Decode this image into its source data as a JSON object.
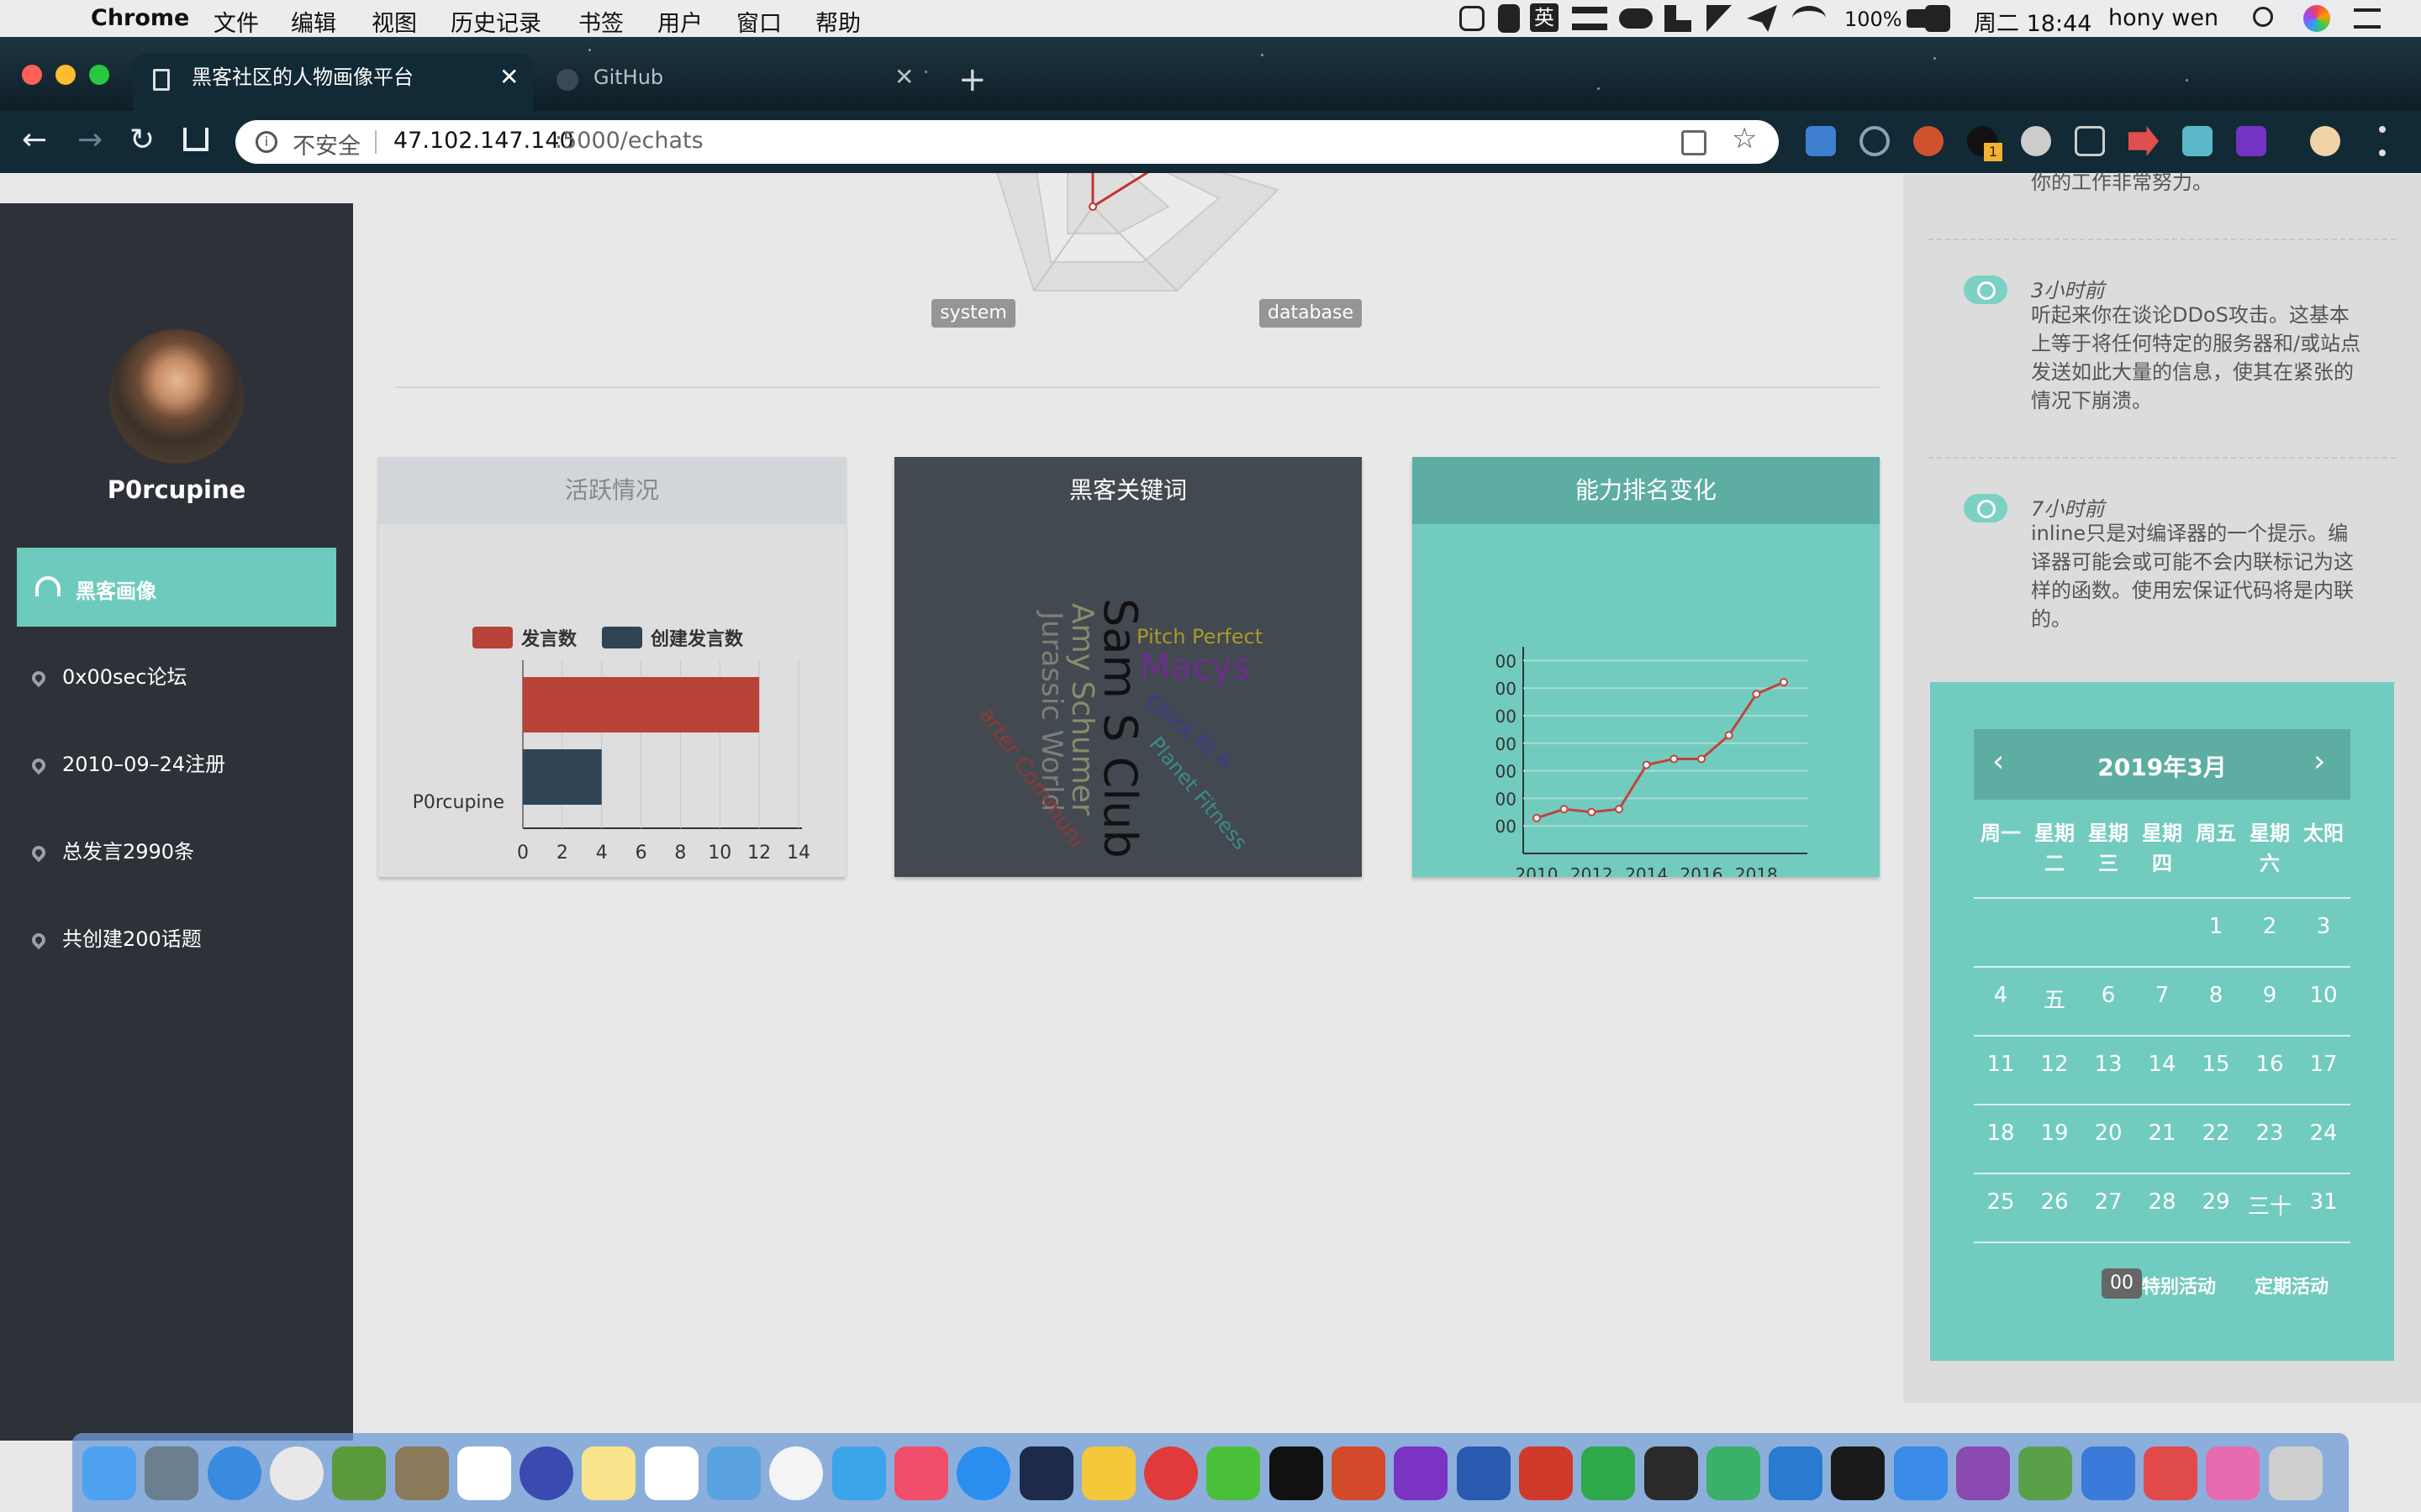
{
  "menubar": {
    "app": "Chrome",
    "menus": [
      "文件",
      "编辑",
      "视图",
      "历史记录",
      "书签",
      "用户",
      "窗口",
      "帮助"
    ],
    "input_method": "英",
    "battery": "100%",
    "clock": "周二 18:44",
    "user": "hony wen"
  },
  "browser": {
    "tabs": [
      {
        "title": "黑客社区的人物画像平台"
      },
      {
        "title": "GitHub"
      }
    ],
    "security_label": "不安全",
    "url_host": "47.102.147.140",
    "url_rest": ":5000/echats",
    "ext_badge": "1"
  },
  "profile": {
    "name": "P0rcupine"
  },
  "nav": {
    "active_label": "黑客画像",
    "items": [
      {
        "label": "0x00sec论坛"
      },
      {
        "label": "2010–09–24注册"
      },
      {
        "label": "总发言2990条"
      },
      {
        "label": "共创建200话题"
      }
    ]
  },
  "radar": {
    "labels": [
      "system",
      "database"
    ]
  },
  "cards": [
    {
      "title": "活跃情况"
    },
    {
      "title": "黑客关键词"
    },
    {
      "title": "能力排名变化"
    }
  ],
  "activity_chart": {
    "chart_data": {
      "type": "bar",
      "orientation": "horizontal",
      "categories": [
        "P0rcupine"
      ],
      "series": [
        {
          "name": "发言数",
          "values": [
            12
          ],
          "color": "#b94239"
        },
        {
          "name": "创建发言数",
          "values": [
            4
          ],
          "color": "#2f4454"
        }
      ],
      "xlim": [
        0,
        14
      ],
      "xticks": [
        "0",
        "2",
        "4",
        "6",
        "8",
        "10",
        "12",
        "14"
      ],
      "legend": "top"
    }
  },
  "wordcloud": {
    "words": [
      {
        "text": "Sam S Club",
        "color": "#111111"
      },
      {
        "text": "Amy Schumer",
        "color": "#8a8a6e"
      },
      {
        "text": "Jurassic World",
        "color": "#7b7f78"
      },
      {
        "text": "Macys",
        "color": "#6b2f8c"
      },
      {
        "text": "Pitch Perfect",
        "color": "#a89a2c"
      },
      {
        "text": "Chick Fil A",
        "color": "#3b3a8f"
      },
      {
        "text": "Planet Fitness",
        "color": "#3c8a8c"
      },
      {
        "text": "arter Communi",
        "color": "#8a3a36"
      }
    ]
  },
  "rank_chart": {
    "chart_data": {
      "type": "line",
      "x": [
        2010,
        2011,
        2012,
        2013,
        2014,
        2015,
        2016,
        2017,
        2018,
        2019
      ],
      "series": [
        {
          "values": [
            1.2,
            1.5,
            1.4,
            1.5,
            3.0,
            3.2,
            3.2,
            4.0,
            5.4,
            5.8
          ],
          "color": "#c0453e"
        }
      ],
      "ylim": [
        0,
        7
      ],
      "ytick_labels": [
        "00",
        "00",
        "00",
        "00",
        "00",
        "00",
        "00"
      ],
      "xticks": [
        "2010",
        "2012",
        "2014",
        "2016",
        "2018"
      ]
    }
  },
  "feed": [
    {
      "text": "你的工作非常努力。"
    },
    {
      "time": "3小时前",
      "text": "听起来你在谈论DDoS攻击。这基本上等于将任何特定的服务器和/或站点发送如此大量的信息，使其在紧张的情况下崩溃。"
    },
    {
      "time": "7小时前",
      "text": "inline只是对编译器的一个提示。编译器可能会或可能不会内联标记为这样的函数。使用宏保证代码将是内联的。"
    }
  ],
  "calendar": {
    "title": "2019年3月",
    "weekdays": [
      "周一",
      "星期二",
      "星期三",
      "星期四",
      "周五",
      "星期六",
      "太阳"
    ],
    "weeks": [
      [
        "",
        "",
        "",
        "",
        "1",
        "2",
        "3"
      ],
      [
        "4",
        "五",
        "6",
        "7",
        "8",
        "9",
        "10"
      ],
      [
        "11",
        "12",
        "13",
        "14",
        "15",
        "16",
        "17"
      ],
      [
        "18",
        "19",
        "20",
        "21",
        "22",
        "23",
        "24"
      ],
      [
        "25",
        "26",
        "27",
        "28",
        "29",
        "三十",
        "31"
      ]
    ],
    "legend": {
      "badge": "00",
      "special": "特别活动",
      "regular": "定期活动"
    }
  }
}
